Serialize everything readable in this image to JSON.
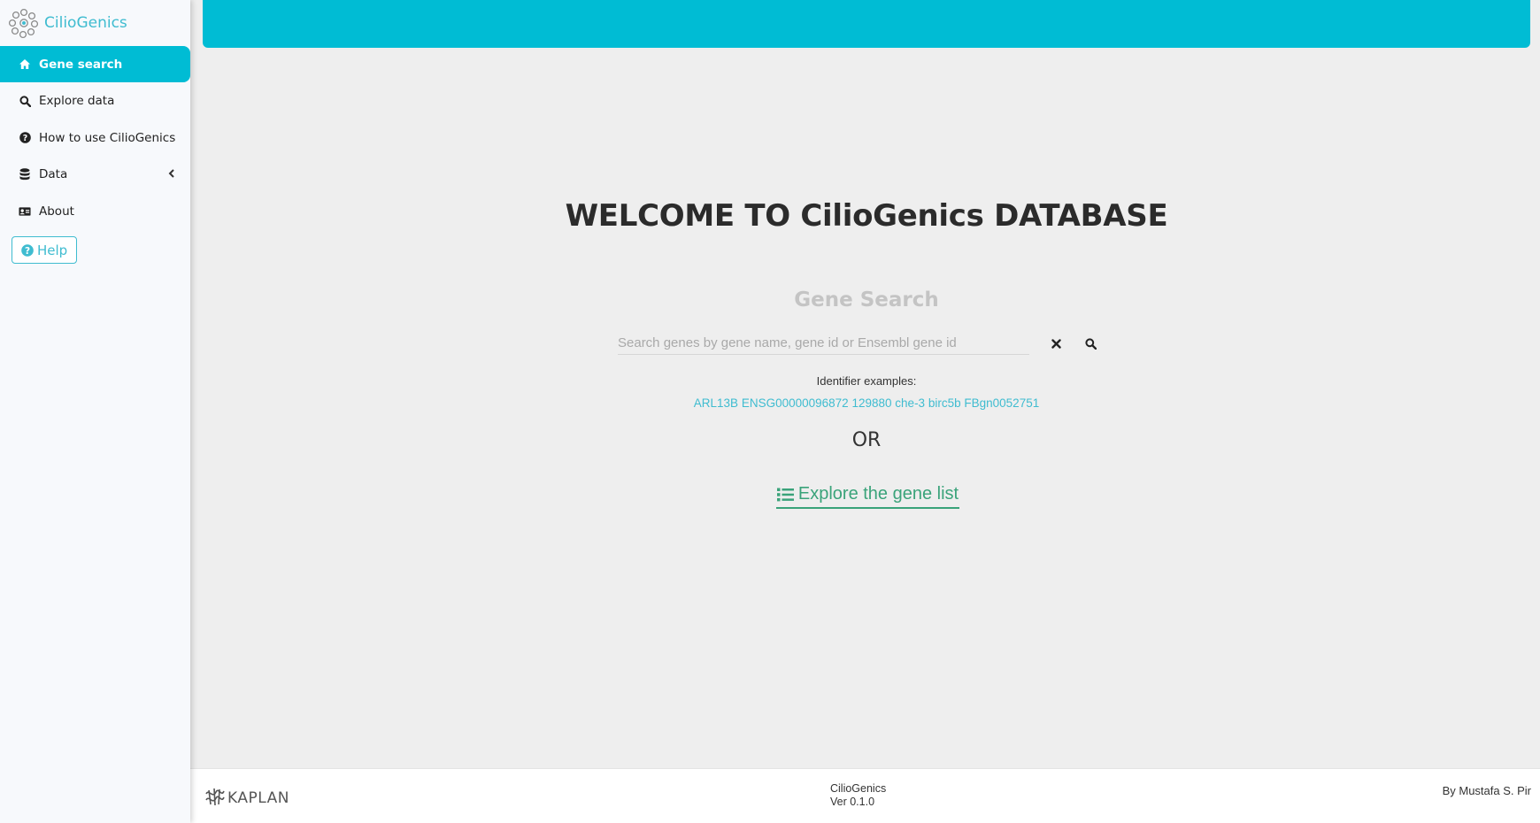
{
  "brand": {
    "name": "CilioGenics",
    "logo_icon": "cilia-cluster-logo"
  },
  "sidebar": {
    "items": [
      {
        "label": "Gene search",
        "icon": "home-icon",
        "active": true
      },
      {
        "label": "Explore data",
        "icon": "search-icon"
      },
      {
        "label": "How to use CilioGenics",
        "icon": "question-circle-icon"
      },
      {
        "label": "Data",
        "icon": "database-icon",
        "has_submenu": true
      },
      {
        "label": "About",
        "icon": "id-card-icon"
      }
    ],
    "help_label": "Help"
  },
  "colors": {
    "accent": "#00bcd4",
    "link": "#3fbcd0",
    "explore": "#3aa37a",
    "background": "#eeeeee"
  },
  "main": {
    "welcome": "WELCOME TO CilioGenics DATABASE",
    "gene_search_title": "Gene Search",
    "search": {
      "placeholder": "Search genes by gene name, gene id or Ensembl gene id",
      "value": ""
    },
    "identifier_label": "Identifier examples:",
    "identifier_examples": [
      "ARL13B",
      "ENSG00000096872",
      "129880",
      "che-3",
      "birc5b",
      "FBgn0052751"
    ],
    "or_text": "OR",
    "explore_label": "Explore the gene list"
  },
  "footer": {
    "logo_text": "KAPLAN",
    "app_name": "CilioGenics",
    "version": "Ver 0.1.0",
    "author": "By Mustafa S. Pir"
  }
}
